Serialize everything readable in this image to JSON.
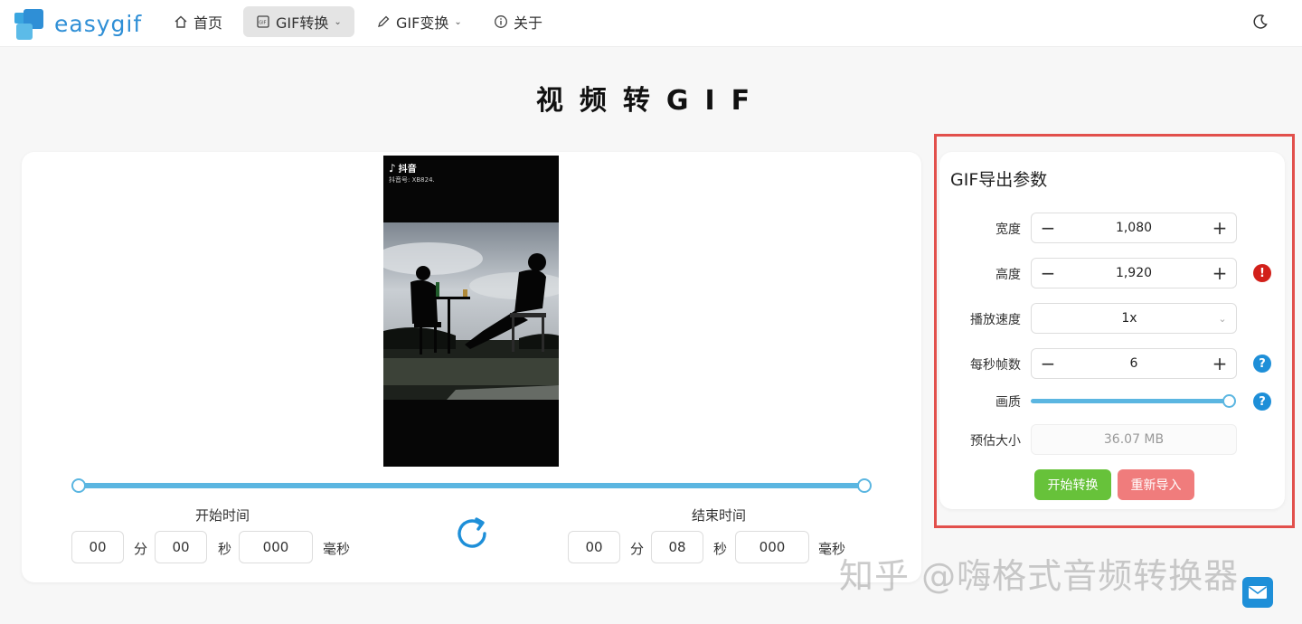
{
  "nav": {
    "logo": "easygif",
    "items": [
      {
        "label": "首页"
      },
      {
        "label": "GIF转换"
      },
      {
        "label": "GIF变换"
      },
      {
        "label": "关于"
      }
    ]
  },
  "page": {
    "title": "视频转GIF"
  },
  "video": {
    "app_name": "抖音",
    "account": "抖音号: XB824."
  },
  "trim": {
    "start": {
      "label": "开始时间",
      "min": "00",
      "sec": "00",
      "ms": "000"
    },
    "end": {
      "label": "结束时间",
      "min": "00",
      "sec": "08",
      "ms": "000"
    },
    "units": {
      "min": "分",
      "sec": "秒",
      "ms": "毫秒"
    }
  },
  "export": {
    "title": "GIF导出参数",
    "width": {
      "label": "宽度",
      "value": "1,080"
    },
    "height": {
      "label": "高度",
      "value": "1,920"
    },
    "speed": {
      "label": "播放速度",
      "value": "1x"
    },
    "fps": {
      "label": "每秒帧数",
      "value": "6"
    },
    "quality": {
      "label": "画质",
      "level": 1.0
    },
    "estimate": {
      "label": "预估大小",
      "value": "36.07 MB"
    },
    "start_button": "开始转换",
    "reimport_button": "重新导入"
  },
  "watermark": "知乎 @嗨格式音频转换器",
  "colors": {
    "accent": "#5bb6e1",
    "brand": "#2f8fd6",
    "success": "#67c23a",
    "danger": "#f07c7c",
    "highlight": "#e2504c"
  }
}
